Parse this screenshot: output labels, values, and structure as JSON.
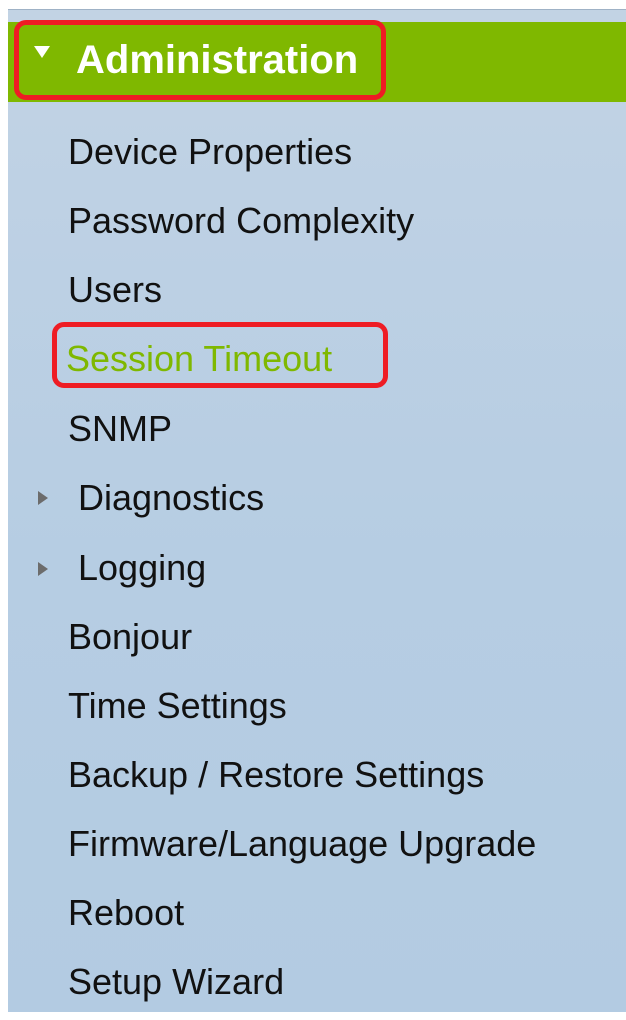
{
  "menu": {
    "header": {
      "label": "Administration",
      "expand_icon": "caret-down-icon",
      "background_color": "#7fb800",
      "highlight_color": "#ee1c24"
    },
    "items": [
      {
        "label": "Device Properties"
      },
      {
        "label": "Password Complexity"
      },
      {
        "label": "Users"
      },
      {
        "label": "Session Timeout",
        "active": true,
        "active_color": "#7fb800",
        "highlighted": true
      },
      {
        "label": "SNMP"
      },
      {
        "label": "Diagnostics",
        "expandable": true,
        "icon": "caret-right-icon"
      },
      {
        "label": "Logging",
        "expandable": true,
        "icon": "caret-right-icon"
      },
      {
        "label": "Bonjour"
      },
      {
        "label": "Time Settings"
      },
      {
        "label": "Backup / Restore Settings"
      },
      {
        "label": "Firmware/Language Upgrade"
      },
      {
        "label": "Reboot"
      },
      {
        "label": "Setup Wizard"
      }
    ]
  }
}
